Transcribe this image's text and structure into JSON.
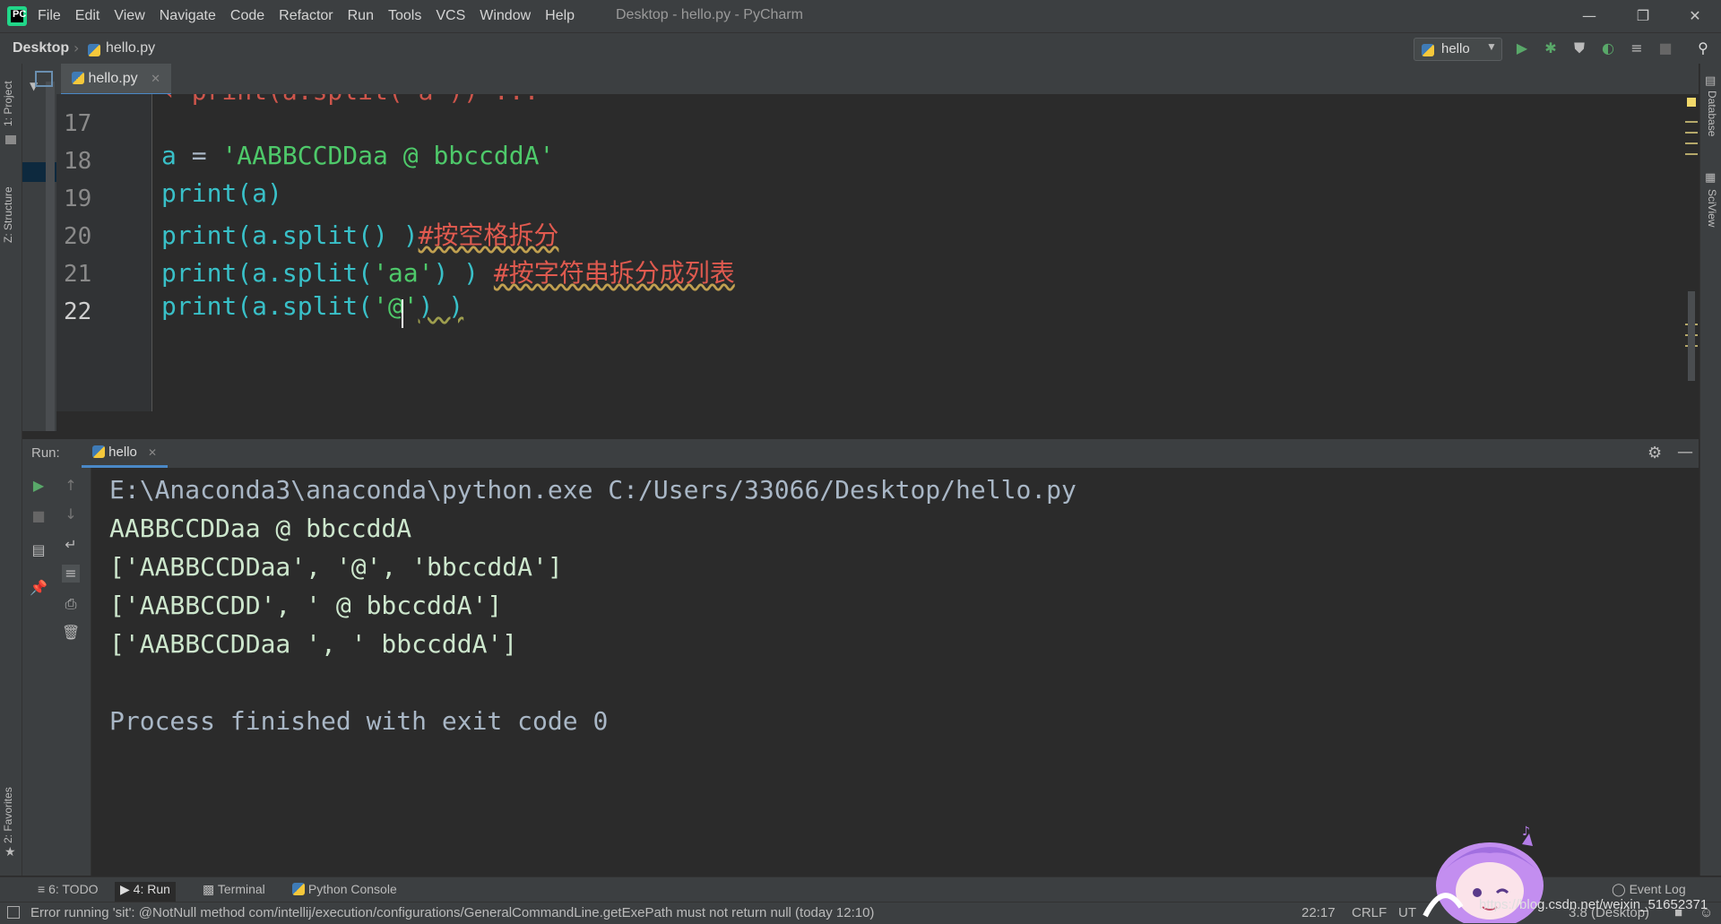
{
  "app": {
    "window_title": "Desktop - hello.py - PyCharm",
    "menu": [
      "File",
      "Edit",
      "View",
      "Navigate",
      "Code",
      "Refactor",
      "Run",
      "Tools",
      "VCS",
      "Window",
      "Help"
    ]
  },
  "navbar": {
    "crumb_root": "Desktop",
    "crumb_file": "hello.py",
    "run_config": "hello"
  },
  "editor": {
    "tab_label": "hello.py",
    "lines": [
      {
        "no": "17"
      },
      {
        "no": "18"
      },
      {
        "no": "19"
      },
      {
        "no": "20"
      },
      {
        "no": "21"
      },
      {
        "no": "22"
      }
    ],
    "code": {
      "l18_a": "a",
      "l18_eq": " = ",
      "l18_str": "'AABBCCDDaa @ bbccddA'",
      "l19": "print(a)",
      "l20_code": "print(a.split() )",
      "l20_cmt": "#按空格拆分",
      "l21_code": "print(a.split(",
      "l21_str": "'aa'",
      "l21_close": ") ) ",
      "l21_cmt": "#按字符串拆分成列表",
      "l22_code": "print(a.split(",
      "l22_str": "'@'",
      "l22_close": ") )"
    }
  },
  "run_panel": {
    "label": "Run:",
    "tab": "hello",
    "output": [
      "E:\\Anaconda3\\anaconda\\python.exe C:/Users/33066/Desktop/hello.py",
      "AABBCCDDaa @ bbccddA",
      "['AABBCCDDaa', '@', 'bbccddA']",
      "['AABBCCDD', ' @ bbccddA']",
      "['AABBCCDDaa ', ' bbccddA']",
      "",
      "Process finished with exit code 0"
    ]
  },
  "left_stripe": {
    "project": "1: Project",
    "structure": "Z: Structure",
    "favorites": "2: Favorites"
  },
  "right_stripe": {
    "database": "Database",
    "sciview": "SciView"
  },
  "bottom_tabs": {
    "todo": "6: TODO",
    "run": "4: Run",
    "terminal": "Terminal",
    "python_console": "Python Console",
    "event_log": "Event Log"
  },
  "status": {
    "message": "Error running 'sit': @NotNull method com/intellij/execution/configurations/GeneralCommandLine.getExePath must not return null (today 12:10)",
    "position": "22:17",
    "line_sep": "CRLF",
    "encoding": "UT",
    "interpreter": "3.8 (Desktop)",
    "watermark": "https://blog.csdn.net/weixin_51652371"
  },
  "colors": {
    "accent": "#4a88c7",
    "run_green": "#59a869",
    "comment": "#e05a4f",
    "string": "#4ec96a",
    "identifier": "#39c0c8"
  }
}
